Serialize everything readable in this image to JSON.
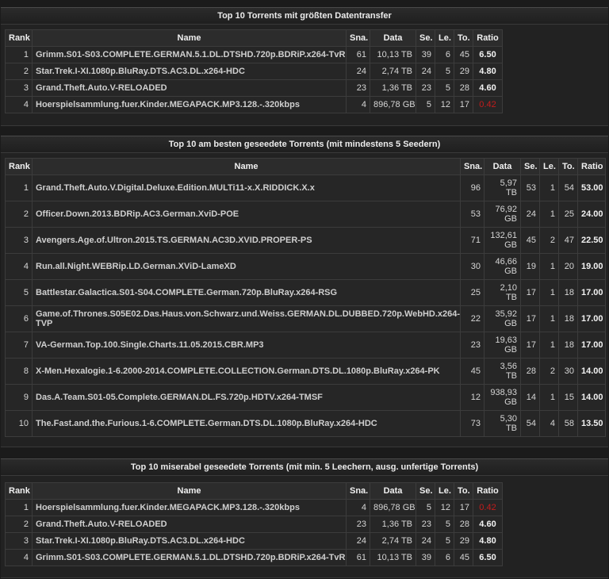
{
  "columns": [
    "Rank",
    "Name",
    "Sna.",
    "Data",
    "Se.",
    "Le.",
    "To.",
    "Ratio"
  ],
  "colors": {
    "ratio_low": "#c41c1c"
  },
  "sections": [
    {
      "title": "Top 10 Torrents mit größten Datentransfer",
      "rows": [
        {
          "rank": "1",
          "name": "Grimm.S01-S03.COMPLETE.GERMAN.5.1.DL.DTSHD.720p.BDRiP.x264-TvR",
          "sna": "61",
          "data": "10,13 TB",
          "se": "39",
          "le": "6",
          "to": "45",
          "ratio": "6.50",
          "low": false
        },
        {
          "rank": "2",
          "name": "Star.Trek.I-XI.1080p.BluRay.DTS.AC3.DL.x264-HDC",
          "sna": "24",
          "data": "2,74 TB",
          "se": "24",
          "le": "5",
          "to": "29",
          "ratio": "4.80",
          "low": false
        },
        {
          "rank": "3",
          "name": "Grand.Theft.Auto.V-RELOADED",
          "sna": "23",
          "data": "1,36 TB",
          "se": "23",
          "le": "5",
          "to": "28",
          "ratio": "4.60",
          "low": false
        },
        {
          "rank": "4",
          "name": "Hoerspielsammlung.fuer.Kinder.MEGAPACK.MP3.128.-.320kbps",
          "sna": "4",
          "data": "896,78 GB",
          "se": "5",
          "le": "12",
          "to": "17",
          "ratio": "0.42",
          "low": true
        }
      ]
    },
    {
      "title": "Top 10 am besten geseedete Torrents (mit mindestens 5 Seedern)",
      "rows": [
        {
          "rank": "1",
          "name": "Grand.Theft.Auto.V.Digital.Deluxe.Edition.MULTi11-x.X.RIDDICK.X.x",
          "sna": "96",
          "data": "5,97 TB",
          "se": "53",
          "le": "1",
          "to": "54",
          "ratio": "53.00",
          "low": false
        },
        {
          "rank": "2",
          "name": "Officer.Down.2013.BDRip.AC3.German.XviD-POE",
          "sna": "53",
          "data": "76,92 GB",
          "se": "24",
          "le": "1",
          "to": "25",
          "ratio": "24.00",
          "low": false
        },
        {
          "rank": "3",
          "name": "Avengers.Age.of.Ultron.2015.TS.GERMAN.AC3D.XVID.PROPER-PS",
          "sna": "71",
          "data": "132,61 GB",
          "se": "45",
          "le": "2",
          "to": "47",
          "ratio": "22.50",
          "low": false
        },
        {
          "rank": "4",
          "name": "Run.all.Night.WEBRip.LD.German.XViD-LameXD",
          "sna": "30",
          "data": "46,66 GB",
          "se": "19",
          "le": "1",
          "to": "20",
          "ratio": "19.00",
          "low": false
        },
        {
          "rank": "5",
          "name": "Battlestar.Galactica.S01-S04.COMPLETE.German.720p.BluRay.x264-RSG",
          "sna": "25",
          "data": "2,10 TB",
          "se": "17",
          "le": "1",
          "to": "18",
          "ratio": "17.00",
          "low": false
        },
        {
          "rank": "6",
          "name": "Game.of.Thrones.S05E02.Das.Haus.von.Schwarz.und.Weiss.GERMAN.DL.DUBBED.720p.WebHD.x264-TVP",
          "sna": "22",
          "data": "35,92 GB",
          "se": "17",
          "le": "1",
          "to": "18",
          "ratio": "17.00",
          "low": false
        },
        {
          "rank": "7",
          "name": "VA-German.Top.100.Single.Charts.11.05.2015.CBR.MP3",
          "sna": "23",
          "data": "19,63 GB",
          "se": "17",
          "le": "1",
          "to": "18",
          "ratio": "17.00",
          "low": false
        },
        {
          "rank": "8",
          "name": "X-Men.Hexalogie.1-6.2000-2014.COMPLETE.COLLECTION.German.DTS.DL.1080p.BluRay.x264-PK",
          "sna": "45",
          "data": "3,56 TB",
          "se": "28",
          "le": "2",
          "to": "30",
          "ratio": "14.00",
          "low": false
        },
        {
          "rank": "9",
          "name": "Das.A.Team.S01-05.Complete.GERMAN.DL.FS.720p.HDTV.x264-TMSF",
          "sna": "12",
          "data": "938,93 GB",
          "se": "14",
          "le": "1",
          "to": "15",
          "ratio": "14.00",
          "low": false
        },
        {
          "rank": "10",
          "name": "The.Fast.and.the.Furious.1-6.COMPLETE.German.DTS.DL.1080p.BluRay.x264-HDC",
          "sna": "73",
          "data": "5,30 TB",
          "se": "54",
          "le": "4",
          "to": "58",
          "ratio": "13.50",
          "low": false
        }
      ]
    },
    {
      "title": "Top 10 miserabel geseedete Torrents (mit min. 5 Leechern, ausg. unfertige Torrents)",
      "rows": [
        {
          "rank": "1",
          "name": "Hoerspielsammlung.fuer.Kinder.MEGAPACK.MP3.128.-.320kbps",
          "sna": "4",
          "data": "896,78 GB",
          "se": "5",
          "le": "12",
          "to": "17",
          "ratio": "0.42",
          "low": true
        },
        {
          "rank": "2",
          "name": "Grand.Theft.Auto.V-RELOADED",
          "sna": "23",
          "data": "1,36 TB",
          "se": "23",
          "le": "5",
          "to": "28",
          "ratio": "4.60",
          "low": false
        },
        {
          "rank": "3",
          "name": "Star.Trek.I-XI.1080p.BluRay.DTS.AC3.DL.x264-HDC",
          "sna": "24",
          "data": "2,74 TB",
          "se": "24",
          "le": "5",
          "to": "29",
          "ratio": "4.80",
          "low": false
        },
        {
          "rank": "4",
          "name": "Grimm.S01-S03.COMPLETE.GERMAN.5.1.DL.DTSHD.720p.BDRiP.x264-TvR",
          "sna": "61",
          "data": "10,13 TB",
          "se": "39",
          "le": "6",
          "to": "45",
          "ratio": "6.50",
          "low": false
        }
      ]
    }
  ]
}
